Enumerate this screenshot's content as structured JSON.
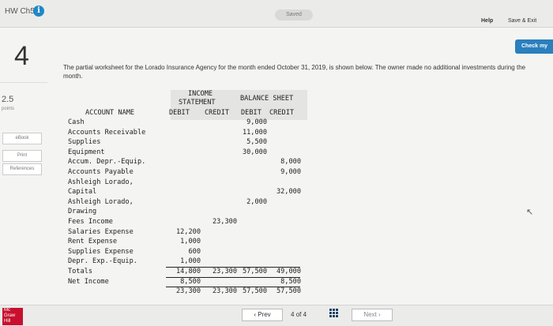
{
  "header": {
    "title": "HW Ch5",
    "info_icon": "i",
    "status": "Saved",
    "help": "Help",
    "save_exit": "Save & Exit",
    "check": "Check my"
  },
  "question": {
    "number": "4",
    "points_value": "2.5",
    "points_label": "points",
    "prompt": "The partial worksheet for the Lorado Insurance Agency for the month ended October 31, 2019, is shown below. The owner made no additional investments during the month."
  },
  "sidebar": {
    "ebook": "eBook",
    "print": "Print",
    "references": "References"
  },
  "worksheet": {
    "headers": {
      "income_statement_1": "INCOME",
      "income_statement_2": "STATEMENT",
      "balance_sheet": "BALANCE SHEET",
      "account_name": "ACCOUNT NAME",
      "is_debit": "DEBIT",
      "is_credit": "CREDIT",
      "bs_debit": "DEBIT",
      "bs_credit": "CREDIT"
    },
    "rows": [
      {
        "name": "Cash",
        "is_debit": "",
        "is_credit": "",
        "bs_debit": "9,000",
        "bs_credit": ""
      },
      {
        "name": "Accounts Receivable",
        "is_debit": "",
        "is_credit": "",
        "bs_debit": "11,000",
        "bs_credit": ""
      },
      {
        "name": "Supplies",
        "is_debit": "",
        "is_credit": "",
        "bs_debit": "5,500",
        "bs_credit": ""
      },
      {
        "name": "Equipment",
        "is_debit": "",
        "is_credit": "",
        "bs_debit": "30,000",
        "bs_credit": ""
      },
      {
        "name": "Accum. Depr.-Equip.",
        "is_debit": "",
        "is_credit": "",
        "bs_debit": "",
        "bs_credit": "8,000"
      },
      {
        "name": "Accounts Payable",
        "is_debit": "",
        "is_credit": "",
        "bs_debit": "",
        "bs_credit": "9,000"
      },
      {
        "name": "Ashleigh Lorado,",
        "is_debit": "",
        "is_credit": "",
        "bs_debit": "",
        "bs_credit": ""
      },
      {
        "name": "Capital",
        "is_debit": "",
        "is_credit": "",
        "bs_debit": "",
        "bs_credit": "32,000"
      },
      {
        "name": "Ashleigh Lorado,",
        "is_debit": "",
        "is_credit": "",
        "bs_debit": "2,000",
        "bs_credit": ""
      },
      {
        "name": "Drawing",
        "is_debit": "",
        "is_credit": "",
        "bs_debit": "",
        "bs_credit": ""
      },
      {
        "name": "Fees Income",
        "is_debit": "",
        "is_credit": "23,300",
        "bs_debit": "",
        "bs_credit": ""
      },
      {
        "name": "Salaries Expense",
        "is_debit": "12,200",
        "is_credit": "",
        "bs_debit": "",
        "bs_credit": ""
      },
      {
        "name": "Rent Expense",
        "is_debit": "1,000",
        "is_credit": "",
        "bs_debit": "",
        "bs_credit": ""
      },
      {
        "name": "Supplies Expense",
        "is_debit": "600",
        "is_credit": "",
        "bs_debit": "",
        "bs_credit": ""
      },
      {
        "name": "Depr. Exp.-Equip.",
        "is_debit": "1,000",
        "is_credit": "",
        "bs_debit": "",
        "bs_credit": ""
      },
      {
        "name": "Totals",
        "is_debit": "14,800",
        "is_credit": "23,300",
        "bs_debit": "57,500",
        "bs_credit": "49,000"
      },
      {
        "name": "Net Income",
        "is_debit": "8,500",
        "is_credit": "",
        "bs_debit": "",
        "bs_credit": "8,500"
      },
      {
        "name": "",
        "is_debit": "23,300",
        "is_credit": "23,300",
        "bs_debit": "57,500",
        "bs_credit": "57,500"
      }
    ]
  },
  "footer": {
    "logo_lines": [
      "Mc",
      "Graw",
      "Hill"
    ],
    "prev": "Prev",
    "page_current": "4",
    "page_of": "of",
    "page_total": "4",
    "next": "Next"
  }
}
